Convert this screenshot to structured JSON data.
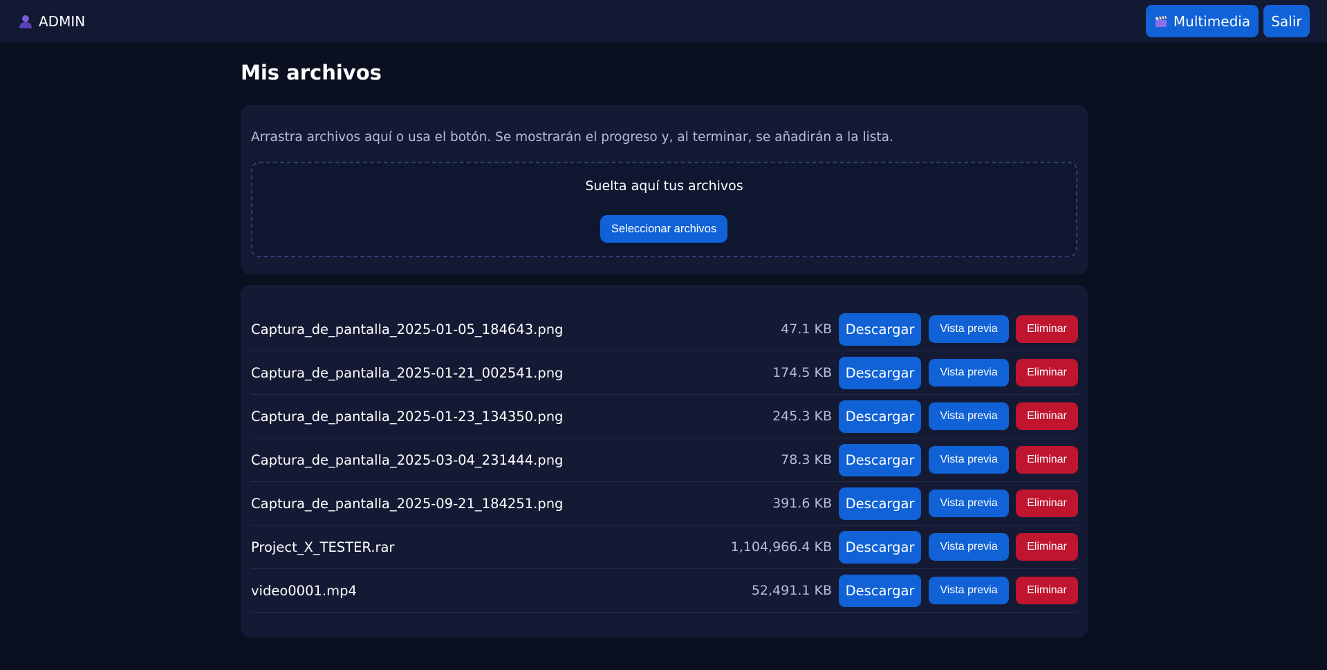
{
  "header": {
    "username": "ADMIN",
    "user_icon": "user-icon",
    "multimedia_label": "Multimedia",
    "multimedia_icon": "clapperboard-icon",
    "logout_label": "Salir"
  },
  "main": {
    "title": "Mis archivos"
  },
  "upload": {
    "hint": "Arrastra archivos aquí o usa el botón. Se mostrarán el progreso y, al terminar, se añadirán a la lista.",
    "drop_text": "Suelta aquí tus archivos",
    "select_label": "Seleccionar archivos"
  },
  "files": [
    {
      "name": "Captura_de_pantalla_2025-01-05_184643.png",
      "size": "47.1 KB"
    },
    {
      "name": "Captura_de_pantalla_2025-01-21_002541.png",
      "size": "174.5 KB"
    },
    {
      "name": "Captura_de_pantalla_2025-01-23_134350.png",
      "size": "245.3 KB"
    },
    {
      "name": "Captura_de_pantalla_2025-03-04_231444.png",
      "size": "78.3 KB"
    },
    {
      "name": "Captura_de_pantalla_2025-09-21_184251.png",
      "size": "391.6 KB"
    },
    {
      "name": "Project_X_TESTER.rar",
      "size": "1,104,966.4 KB"
    },
    {
      "name": "video0001.mp4",
      "size": "52,491.1 KB"
    }
  ],
  "actions": {
    "download_label": "Descargar",
    "preview_label": "Vista previa",
    "delete_label": "Eliminar"
  },
  "colors": {
    "background": "#0b1020",
    "card": "#141a33",
    "primary": "#1162d6",
    "danger": "#c0152f"
  }
}
